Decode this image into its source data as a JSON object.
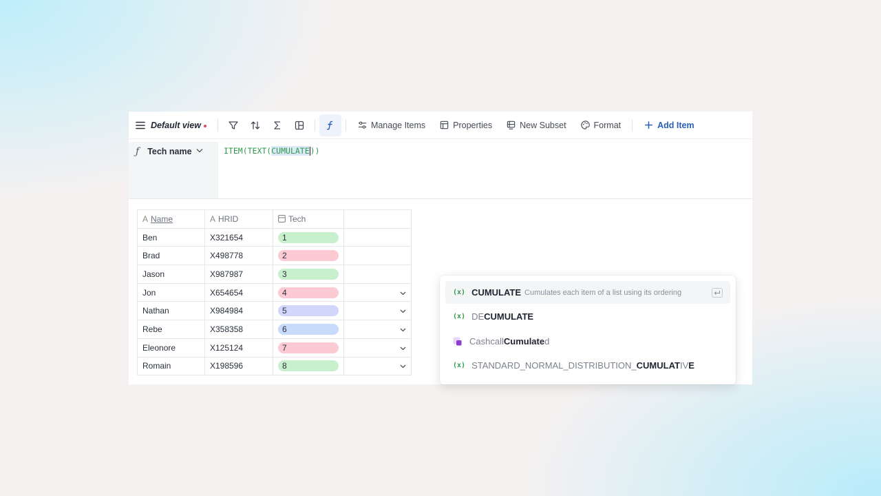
{
  "toolbar": {
    "view_name": "Default view",
    "manage_items": "Manage Items",
    "properties": "Properties",
    "new_subset": "New Subset",
    "format": "Format",
    "add_item": "Add Item"
  },
  "formula": {
    "column_name": "Tech name",
    "prefix": "ITEM(TEXT(",
    "selected": "CUMULATE",
    "suffix": "))"
  },
  "autocomplete": {
    "items": [
      {
        "type": "function",
        "pre": "",
        "match": "CUMULATE",
        "post": "",
        "description": "Cumulates each item of a list using its ordering",
        "highlighted": true
      },
      {
        "type": "function",
        "pre": "DE",
        "match": "CUMULATE",
        "post": "",
        "description": "",
        "highlighted": false
      },
      {
        "type": "list",
        "pre": "Cashcall ",
        "match": "Cumulate",
        "post": "d",
        "description": "",
        "highlighted": false
      },
      {
        "type": "function",
        "pre": "STANDARD_NORMAL_DISTRIBUTION_",
        "match": "CUMULAT",
        "post": "IV",
        "post_bold": "E",
        "description": "",
        "highlighted": false
      }
    ]
  },
  "table": {
    "columns": [
      "Name",
      "HRID",
      "Tech"
    ],
    "rows": [
      {
        "name": "Ben",
        "hrid": "X321654",
        "tech": "1",
        "color": "g"
      },
      {
        "name": "Brad",
        "hrid": "X498778",
        "tech": "2",
        "color": "r"
      },
      {
        "name": "Jason",
        "hrid": "X987987",
        "tech": "3",
        "color": "g"
      },
      {
        "name": "Jon",
        "hrid": "X654654",
        "tech": "4",
        "color": "r"
      },
      {
        "name": "Nathan",
        "hrid": "X984984",
        "tech": "5",
        "color": "v"
      },
      {
        "name": "Rebe",
        "hrid": "X358358",
        "tech": "6",
        "color": "b"
      },
      {
        "name": "Eleonore",
        "hrid": "X125124",
        "tech": "7",
        "color": "r"
      },
      {
        "name": "Romain",
        "hrid": "X198596",
        "tech": "8",
        "color": "g"
      }
    ]
  },
  "colors": {
    "accent": "#2b5fb4",
    "function_green": "#2f9b4a",
    "unsaved_dot": "#e0475f"
  }
}
